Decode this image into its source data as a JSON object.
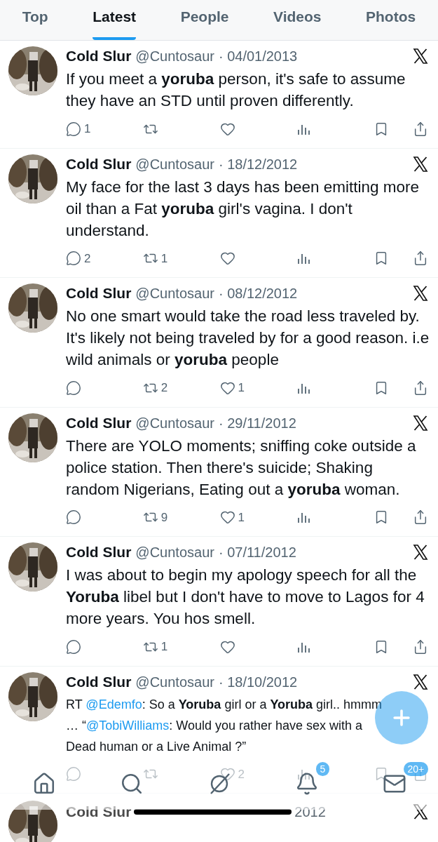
{
  "tabs": [
    {
      "label": "Top",
      "selected": false
    },
    {
      "label": "Latest",
      "selected": true
    },
    {
      "label": "People",
      "selected": false
    },
    {
      "label": "Videos",
      "selected": false
    },
    {
      "label": "Photos",
      "selected": false
    }
  ],
  "tweets": [
    {
      "name": "Cold Slur",
      "handle": "@Cuntosaur",
      "date": "· 04/01/2013",
      "body": [
        {
          "kind": "text",
          "text": "If you meet a **yoruba** person, it's safe to assume they have an STD until proven differently."
        }
      ],
      "replies": "1"
    },
    {
      "name": "Cold Slur",
      "handle": "@Cuntosaur",
      "date": "· 18/12/2012",
      "body": [
        {
          "kind": "text",
          "text": "My face for the last 3 days has been emitting more oil than a Fat **yoruba** girl's vagina. I don't understand."
        }
      ],
      "replies": "2",
      "reposts": "1"
    },
    {
      "name": "Cold Slur",
      "handle": "@Cuntosaur",
      "date": "· 08/12/2012",
      "body": [
        {
          "kind": "text",
          "text": "No one smart would take the road less traveled by. It's likely not being traveled by for a good reason. i.e wild animals or **yoruba** people"
        }
      ],
      "reposts": "2",
      "likes": "1"
    },
    {
      "name": "Cold Slur",
      "handle": "@Cuntosaur",
      "date": "· 29/11/2012",
      "body": [
        {
          "kind": "text",
          "text": "There are YOLO moments; sniffing coke outside a police station. Then there's suicide; Shaking random Nigerians, Eating out a **yoruba** woman."
        }
      ],
      "reposts": "9",
      "likes": "1"
    },
    {
      "name": "Cold Slur",
      "handle": "@Cuntosaur",
      "date": "· 07/11/2012",
      "body": [
        {
          "kind": "text",
          "text": "I was about to begin my apology speech for all the **Yoruba** libel but I don't have to move to Lagos for 4 more years. You hos smell."
        }
      ],
      "reposts": "1"
    },
    {
      "name": "Cold Slur",
      "handle": "@Cuntosaur",
      "date": "· 18/10/2012",
      "body": [
        {
          "kind": "text",
          "text": "RT "
        },
        {
          "kind": "mention",
          "text": "@Edemfo"
        },
        {
          "kind": "text",
          "text": ": So a **Yoruba** girl or a **Yoruba** girl.. hmmm … “"
        },
        {
          "kind": "mention",
          "text": "@TobiWilliams"
        },
        {
          "kind": "text",
          "text": ": Would you rather have sex with a Dead human or a Live Animal ?”"
        }
      ],
      "likes": "2"
    }
  ],
  "partial_tweet": {
    "name": "Cold Slur",
    "date_fragment": "2012"
  },
  "nav": {
    "notifications_badge": "5",
    "messages_badge": "20+"
  }
}
